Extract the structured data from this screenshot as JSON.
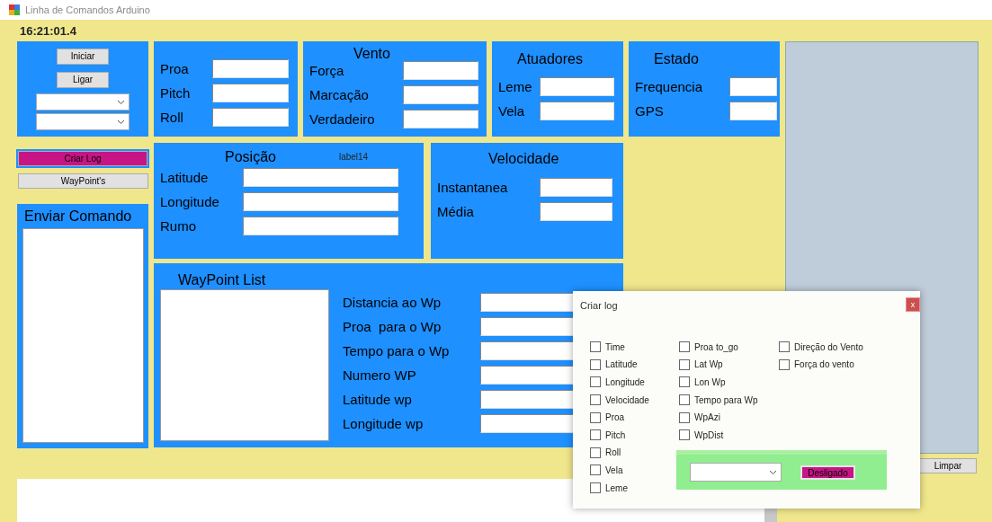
{
  "window": {
    "title": "Linha de Comandos Arduino"
  },
  "clock": "16:21:01.4",
  "control_panel": {
    "buttons": [
      "Iniciar",
      "Ligar"
    ]
  },
  "side_buttons": [
    {
      "label": "Criar Log",
      "kind": "active"
    },
    {
      "label": "WayPoint's",
      "kind": "plain"
    }
  ],
  "enviar_comando": {
    "title": "Enviar Comando"
  },
  "attitude": {
    "fields": [
      "Proa",
      "Pitch",
      "Roll"
    ]
  },
  "vento": {
    "title": "Vento",
    "fields": [
      "Força",
      "Marcação",
      "Verdadeiro"
    ]
  },
  "atuadores": {
    "title": "Atuadores",
    "fields": [
      "Leme",
      "Vela"
    ]
  },
  "estado": {
    "title": "Estado",
    "fields": [
      "Frequencia",
      "GPS"
    ]
  },
  "posicao": {
    "title": "Posição",
    "note": "label14",
    "fields": [
      "Latitude",
      "Longitude",
      "Rumo"
    ]
  },
  "velocidade": {
    "title": "Velocidade",
    "fields": [
      "Instantanea",
      "Média"
    ]
  },
  "waypoint": {
    "title": "WayPoint List",
    "fields": [
      "Distancia ao Wp",
      "Proa  para o Wp",
      "Tempo para o Wp",
      "Numero WP",
      "Latitude wp",
      "Longitude wp"
    ]
  },
  "limpar_button": "Limpar",
  "dialog": {
    "title": "Criar log",
    "close": "x",
    "columns": [
      [
        {
          "label": "Time",
          "checked": false
        },
        {
          "label": "Latitude",
          "checked": false
        },
        {
          "label": "Longitude",
          "checked": false
        },
        {
          "label": "Velocidade",
          "checked": false
        },
        {
          "label": "Proa",
          "checked": false
        },
        {
          "label": "Pitch",
          "checked": false
        },
        {
          "label": "Roll",
          "checked": false
        },
        {
          "label": "Vela",
          "checked": false
        },
        {
          "label": "Leme",
          "checked": false
        }
      ],
      [
        {
          "label": "Proa to_go",
          "checked": false
        },
        {
          "label": "Lat Wp",
          "checked": false
        },
        {
          "label": "Lon Wp",
          "checked": false
        },
        {
          "label": "Tempo para Wp",
          "checked": false
        },
        {
          "label": "WpAzi",
          "checked": false
        },
        {
          "label": "WpDist",
          "checked": false
        }
      ],
      [
        {
          "label": "Direção do Vento",
          "checked": false
        },
        {
          "label": "Força do vento",
          "checked": false
        }
      ]
    ],
    "toggle_button": "Desligado"
  }
}
